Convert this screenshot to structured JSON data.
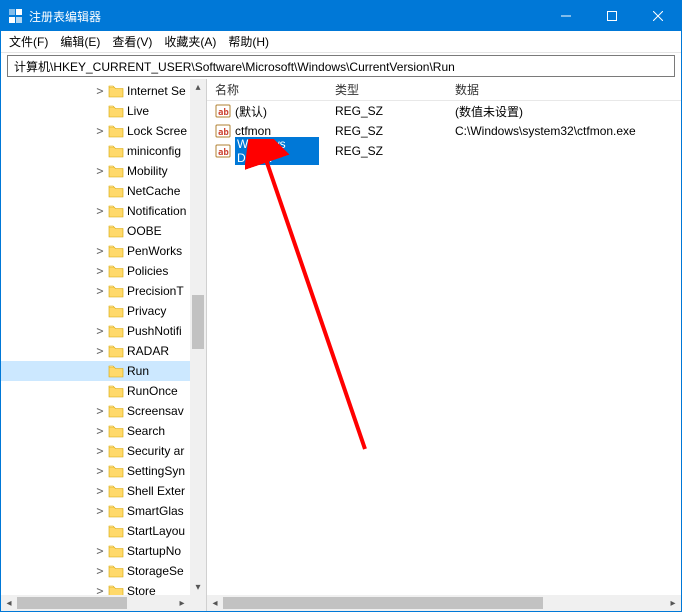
{
  "title": "注册表编辑器",
  "menus": {
    "file": "文件(F)",
    "edit": "编辑(E)",
    "view": "查看(V)",
    "favorites": "收藏夹(A)",
    "help": "帮助(H)"
  },
  "address": "计算机\\HKEY_CURRENT_USER\\Software\\Microsoft\\Windows\\CurrentVersion\\Run",
  "tree": [
    {
      "label": "Internet Se",
      "exp": ">"
    },
    {
      "label": "Live",
      "exp": ""
    },
    {
      "label": "Lock Scree",
      "exp": ">"
    },
    {
      "label": "miniconfig",
      "exp": ""
    },
    {
      "label": "Mobility",
      "exp": ">"
    },
    {
      "label": "NetCache",
      "exp": ""
    },
    {
      "label": "Notification",
      "exp": ">"
    },
    {
      "label": "OOBE",
      "exp": ""
    },
    {
      "label": "PenWorks",
      "exp": ">"
    },
    {
      "label": "Policies",
      "exp": ">"
    },
    {
      "label": "PrecisionT",
      "exp": ">"
    },
    {
      "label": "Privacy",
      "exp": ""
    },
    {
      "label": "PushNotifi",
      "exp": ">"
    },
    {
      "label": "RADAR",
      "exp": ">"
    },
    {
      "label": "Run",
      "exp": "",
      "selected": true
    },
    {
      "label": "RunOnce",
      "exp": ""
    },
    {
      "label": "Screensav",
      "exp": ">"
    },
    {
      "label": "Search",
      "exp": ">"
    },
    {
      "label": "Security ar",
      "exp": ">"
    },
    {
      "label": "SettingSyn",
      "exp": ">"
    },
    {
      "label": "Shell Exter",
      "exp": ">"
    },
    {
      "label": "SmartGlas",
      "exp": ">"
    },
    {
      "label": "StartLayou",
      "exp": ""
    },
    {
      "label": "StartupNo",
      "exp": ">"
    },
    {
      "label": "StorageSe",
      "exp": ">"
    },
    {
      "label": "Store",
      "exp": ">"
    }
  ],
  "columns": {
    "name": "名称",
    "type": "类型",
    "data": "数据"
  },
  "rows": [
    {
      "name": "(默认)",
      "type": "REG_SZ",
      "data": "(数值未设置)",
      "selected": false
    },
    {
      "name": "ctfmon",
      "type": "REG_SZ",
      "data": "C:\\Windows\\system32\\ctfmon.exe",
      "selected": false
    },
    {
      "name": "Windows Defe...",
      "type": "REG_SZ",
      "data": "",
      "selected": true
    }
  ]
}
